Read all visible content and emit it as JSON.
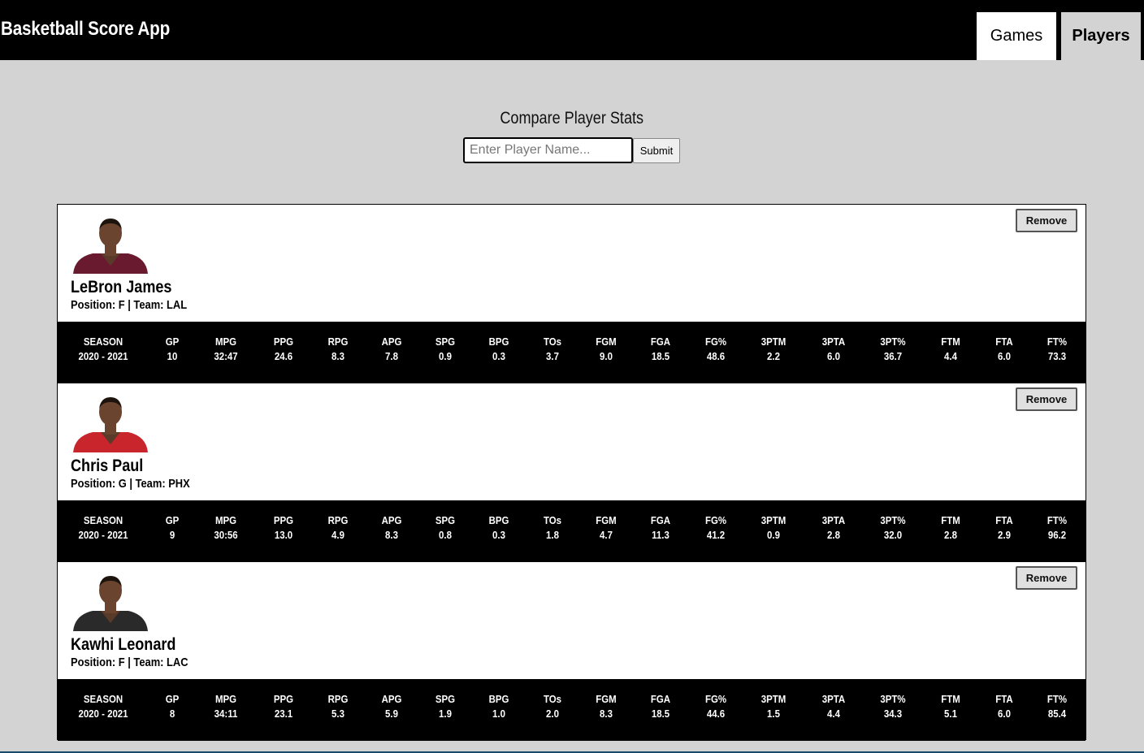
{
  "app": {
    "title": "Basketball Score App"
  },
  "nav": {
    "games": "Games",
    "players": "Players"
  },
  "compare": {
    "title": "Compare Player Stats",
    "placeholder": "Enter Player Name...",
    "value": "",
    "submit": "Submit"
  },
  "stat_headers": [
    "SEASON",
    "GP",
    "MPG",
    "PPG",
    "RPG",
    "APG",
    "SPG",
    "BPG",
    "TOs",
    "FGM",
    "FGA",
    "FG%",
    "3PTM",
    "3PTA",
    "3PT%",
    "FTM",
    "FTA",
    "FT%"
  ],
  "players": [
    {
      "name": "LeBron James",
      "meta": "Position: F | Team: LAL",
      "remove": "Remove",
      "jersey_color": "#6a1a2e",
      "stats": [
        "2020 - 2021",
        "10",
        "32:47",
        "24.6",
        "8.3",
        "7.8",
        "0.9",
        "0.3",
        "3.7",
        "9.0",
        "18.5",
        "48.6",
        "2.2",
        "6.0",
        "36.7",
        "4.4",
        "6.0",
        "73.3"
      ]
    },
    {
      "name": "Chris Paul",
      "meta": "Position: G | Team: PHX",
      "remove": "Remove",
      "jersey_color": "#c8262c",
      "stats": [
        "2020 - 2021",
        "9",
        "30:56",
        "13.0",
        "4.9",
        "8.3",
        "0.8",
        "0.3",
        "1.8",
        "4.7",
        "11.3",
        "41.2",
        "0.9",
        "2.8",
        "32.0",
        "2.8",
        "2.9",
        "96.2"
      ]
    },
    {
      "name": "Kawhi Leonard",
      "meta": "Position: F | Team: LAC",
      "remove": "Remove",
      "jersey_color": "#2a2a2a",
      "stats": [
        "2020 - 2021",
        "8",
        "34:11",
        "23.1",
        "5.3",
        "5.9",
        "1.9",
        "1.0",
        "2.0",
        "8.3",
        "18.5",
        "44.6",
        "1.5",
        "4.4",
        "34.3",
        "5.1",
        "6.0",
        "85.4"
      ]
    }
  ]
}
